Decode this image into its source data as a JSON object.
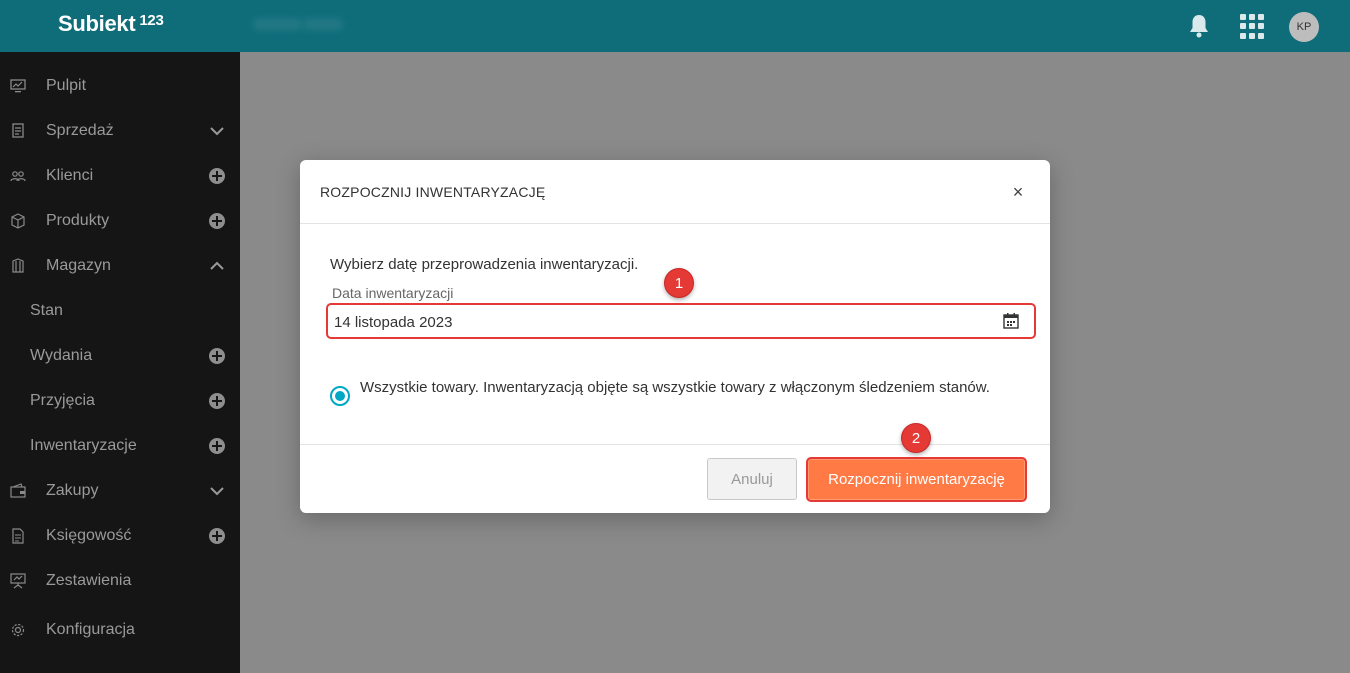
{
  "app": {
    "logo": "Subiekt",
    "logo_sup": "123",
    "blurred_text": "XXXXX XXXX",
    "avatar_initials": "KP"
  },
  "sidebar": {
    "items": [
      {
        "label": "Pulpit",
        "icon": "monitor-icon",
        "action": "none"
      },
      {
        "label": "Sprzedaż",
        "icon": "receipt-icon",
        "action": "chevron-down"
      },
      {
        "label": "Klienci",
        "icon": "people-icon",
        "action": "plus"
      },
      {
        "label": "Produkty",
        "icon": "box-icon",
        "action": "plus"
      },
      {
        "label": "Magazyn",
        "icon": "warehouse-icon",
        "action": "chevron-up"
      },
      {
        "label": "Stan",
        "sub": true,
        "action": "none"
      },
      {
        "label": "Wydania",
        "sub": true,
        "action": "plus"
      },
      {
        "label": "Przyjęcia",
        "sub": true,
        "action": "plus"
      },
      {
        "label": "Inwentaryzacje",
        "sub": true,
        "action": "plus"
      },
      {
        "label": "Zakupy",
        "icon": "wallet-icon",
        "action": "chevron-down"
      },
      {
        "label": "Księgowość",
        "icon": "document-icon",
        "action": "plus"
      },
      {
        "label": "Zestawienia",
        "icon": "presentation-icon",
        "action": "none"
      },
      {
        "label": "Konfiguracja",
        "icon": "gear-icon",
        "action": "none"
      }
    ]
  },
  "modal": {
    "title": "ROZPOCZNIJ INWENTARYZACJĘ",
    "close": "×",
    "intro": "Wybierz datę przeprowadzenia inwentaryzacji.",
    "date_label": "Data inwentaryzacji",
    "date_value": "14 listopada 2023",
    "radio_label": "Wszystkie towary. Inwentaryzacją objęte są wszystkie towary z włączonym śledzeniem stanów.",
    "cancel_label": "Anuluj",
    "start_label": "Rozpocznij inwentaryzację"
  },
  "markers": {
    "step1": "1",
    "step2": "2"
  },
  "colors": {
    "topbar": "#0f6d7a",
    "sidebar": "#151515",
    "accent": "#ff7a45",
    "highlight": "#e53935",
    "radio": "#00a8c4"
  }
}
